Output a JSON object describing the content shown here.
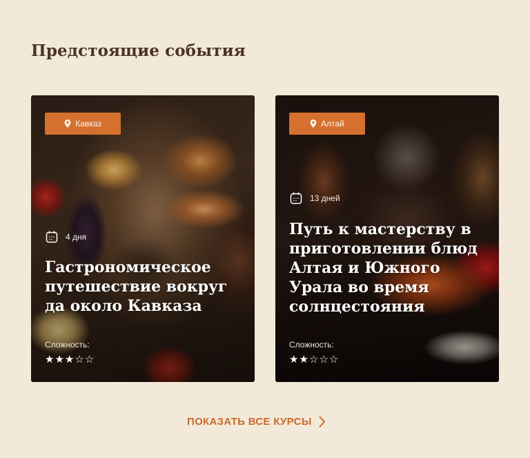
{
  "section": {
    "title": "Предстоящие события"
  },
  "cards": [
    {
      "location": "Кавказ",
      "duration": "4 дня",
      "title": "Гастрономическое путешествие вокруг да около Кавказа",
      "difficulty_label": "Сложность:",
      "difficulty": 3,
      "difficulty_max": 5
    },
    {
      "location": "Алтай",
      "duration": "13 дней",
      "title": "Путь к мастерству в приготовлении блюд Алтая и Южного Урала во время солнцестояния",
      "difficulty_label": "Сложность:",
      "difficulty": 2,
      "difficulty_max": 5
    }
  ],
  "show_all": {
    "label": "ПОКАЗАТЬ ВСЕ КУРСЫ"
  },
  "icons": {
    "location": "map-pin-icon",
    "duration": "calendar-icon",
    "rating": "star-icon",
    "more": "chevron-right-icon"
  },
  "colors": {
    "background": "#f2e9d9",
    "accent": "#d5702f",
    "link": "#c96a2c",
    "heading": "#4a3227"
  }
}
